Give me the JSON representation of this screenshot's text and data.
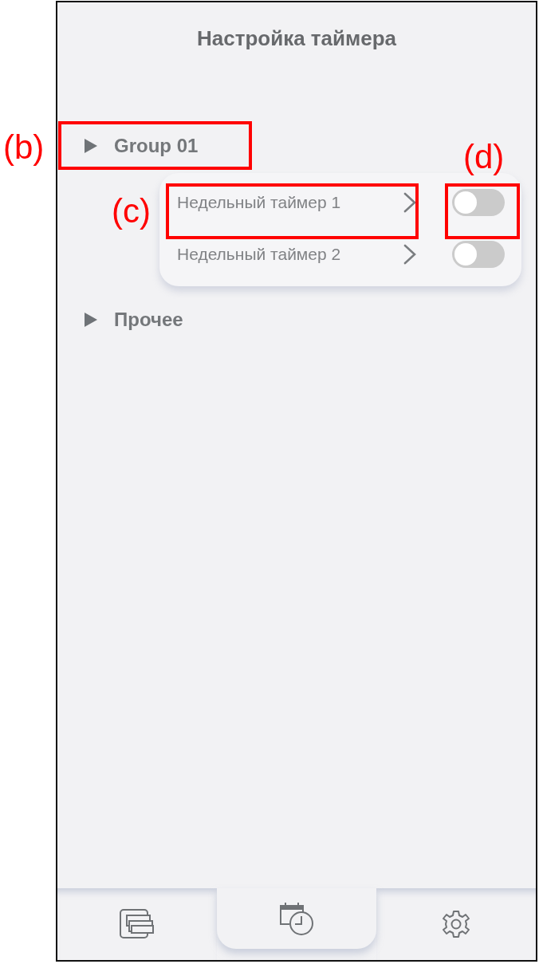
{
  "title": "Настройка таймера",
  "groups": [
    {
      "label": "Group 01",
      "timers": [
        {
          "label": "Недельный таймер 1",
          "on": false
        },
        {
          "label": "Недельный таймер 2",
          "on": false
        }
      ]
    },
    {
      "label": "Прочее"
    }
  ],
  "tabs": [
    {
      "selected": false
    },
    {
      "selected": true
    },
    {
      "selected": false
    }
  ],
  "annotations": [
    {
      "label": "(b)"
    },
    {
      "label": "(c)"
    },
    {
      "label": "(d)"
    }
  ]
}
